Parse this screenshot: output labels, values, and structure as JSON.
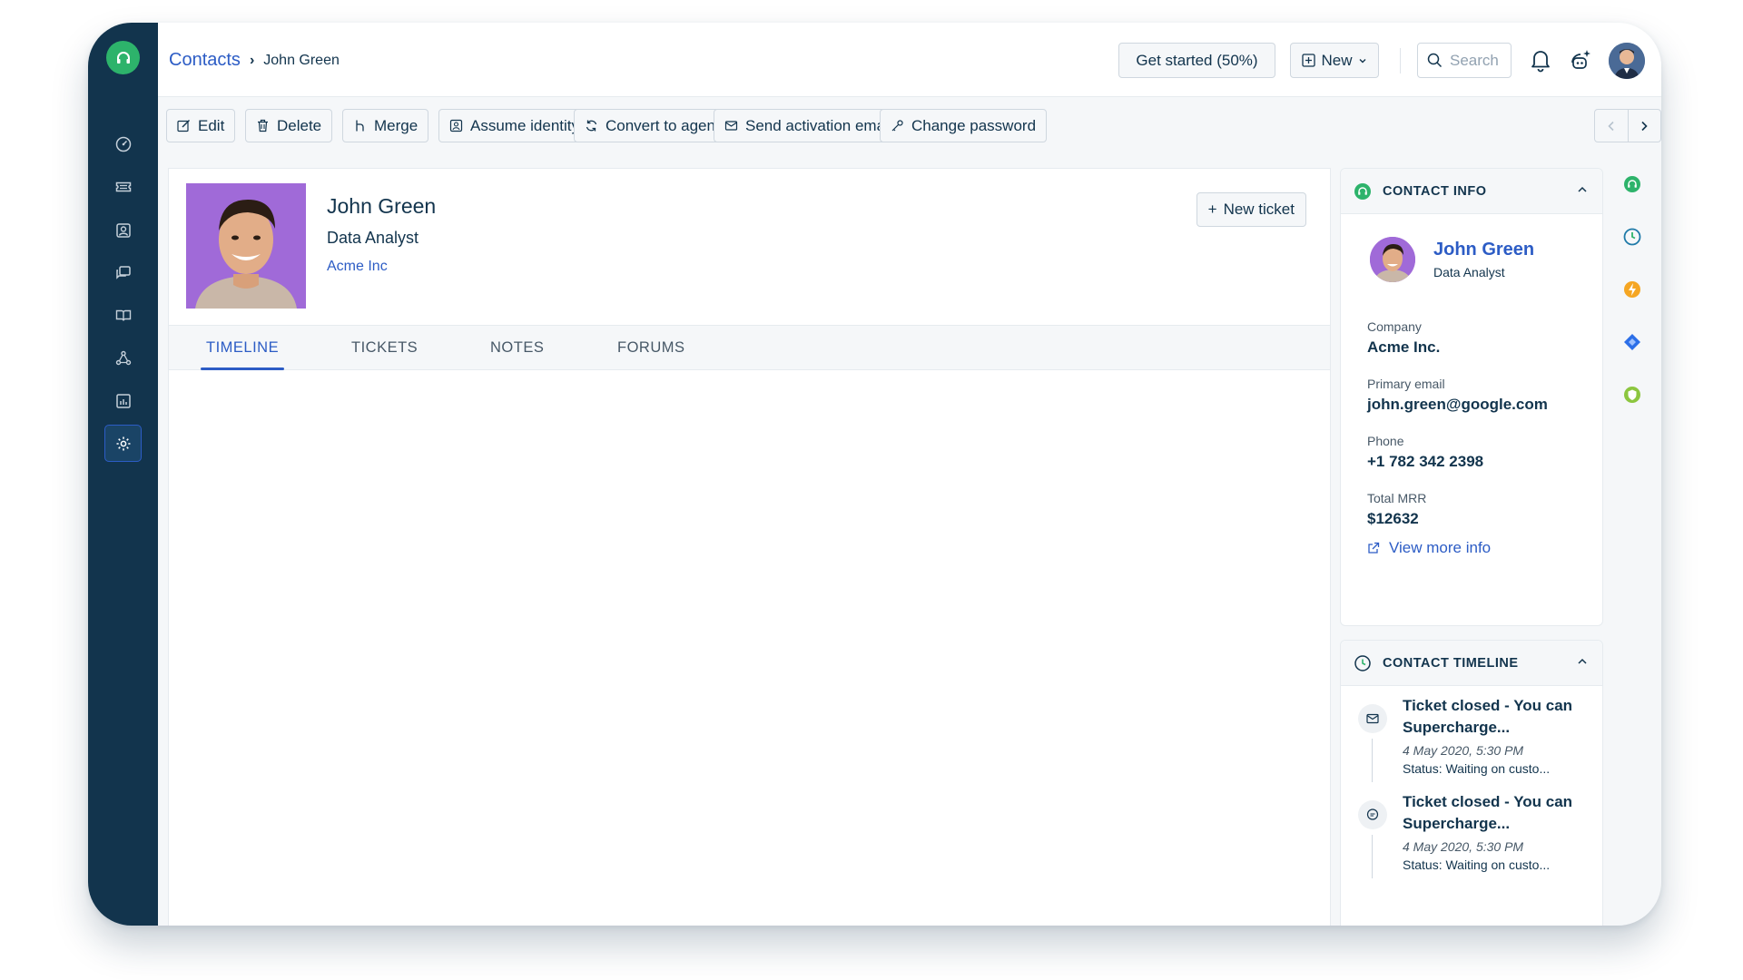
{
  "header": {
    "breadcrumb_root": "Contacts",
    "breadcrumb_separator": "›",
    "breadcrumb_current": "John Green",
    "get_started_label": "Get started (50%)",
    "new_label": "New",
    "search_placeholder": "Search"
  },
  "sidebar": {
    "items": [
      {
        "name": "dashboard",
        "icon": "dashboard-icon"
      },
      {
        "name": "tickets",
        "icon": "ticket-icon"
      },
      {
        "name": "contacts",
        "icon": "contact-icon"
      },
      {
        "name": "conversations",
        "icon": "chat-icon"
      },
      {
        "name": "solutions",
        "icon": "book-icon"
      },
      {
        "name": "social",
        "icon": "network-icon"
      },
      {
        "name": "reports",
        "icon": "reports-icon"
      },
      {
        "name": "admin",
        "icon": "gear-icon",
        "active": true
      }
    ]
  },
  "toolbar": {
    "edit": "Edit",
    "delete": "Delete",
    "merge": "Merge",
    "assume_identity": "Assume identity",
    "convert_to_agent": "Convert to agent",
    "send_activation_email": "Send activation email",
    "change_password": "Change password"
  },
  "profile": {
    "name": "John Green",
    "title": "Data Analyst",
    "company": "Acme Inc",
    "new_ticket_label": "New ticket"
  },
  "tabs": [
    "TIMELINE",
    "TICKETS",
    "NOTES",
    "FORUMS"
  ],
  "active_tab": "TIMELINE",
  "contact_info": {
    "heading": "CONTACT INFO",
    "name": "John Green",
    "title": "Data Analyst",
    "company_label": "Company",
    "company_value": "Acme Inc.",
    "email_label": "Primary email",
    "email_value": "john.green@google.com",
    "phone_label": "Phone",
    "phone_value": "+1 782 342 2398",
    "mrr_label": "Total MRR",
    "mrr_value": "$12632",
    "view_more": "View more info"
  },
  "contact_timeline": {
    "heading": "CONTACT TIMELINE",
    "items": [
      {
        "icon": "email-icon",
        "title": "Ticket closed - You can Supercharge...",
        "date": "4 May 2020, 5:30 PM",
        "status": "Status: Waiting on custo..."
      },
      {
        "icon": "chat-bubble-icon",
        "title": "Ticket closed - You can Supercharge...",
        "date": "4 May 2020, 5:30 PM",
        "status": "Status: Waiting on custo..."
      }
    ]
  },
  "colors": {
    "sidebar": "#12344d",
    "accent": "#2c5cc5",
    "brand_green": "#2db36b",
    "photo_bg": "#a06ad8"
  }
}
